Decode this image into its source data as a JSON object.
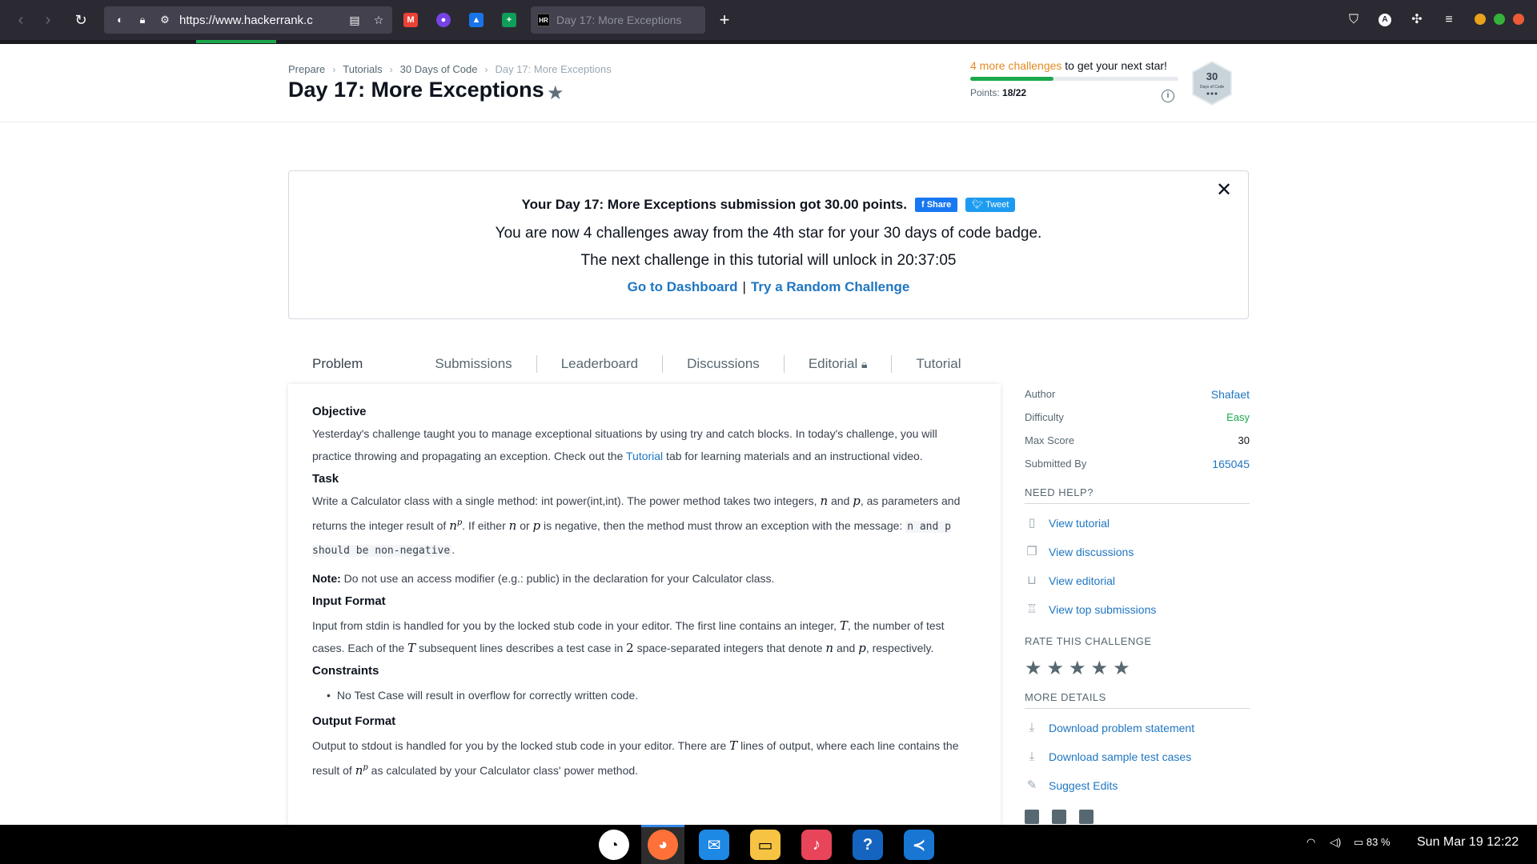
{
  "browser": {
    "url_host": "https://www.hackerrank.c",
    "tab_title": "Day 17: More Exceptions",
    "tab_favicon": "HR",
    "new_tab_glyph": "+"
  },
  "breadcrumb": [
    "Prepare",
    "Tutorials",
    "30 Days of Code",
    "Day 17: More Exceptions"
  ],
  "header": {
    "title": "Day 17: More Exceptions",
    "progress_accent": "4 more challenges",
    "progress_rest": " to get your next star!",
    "progress_fraction": 0.4,
    "points_label": "Points:",
    "points_value": "18/22",
    "badge_number": "30",
    "badge_caption": "Days of Code"
  },
  "success": {
    "message": "Your Day 17: More Exceptions submission got 30.00 points.",
    "share_label": "Share",
    "tweet_label": "Tweet",
    "line2": "You are now 4 challenges away from the 4th star for your 30 days of code badge.",
    "line3": "The next challenge in this tutorial will unlock in 20:37:05",
    "dashboard_link": "Go to Dashboard",
    "separator": "|",
    "random_link": "Try a Random Challenge"
  },
  "tabs": [
    "Problem",
    "Submissions",
    "Leaderboard",
    "Discussions",
    "Editorial",
    "Tutorial"
  ],
  "problem": {
    "objective_heading": "Objective",
    "objective_text_1": "Yesterday's challenge taught you to manage exceptional situations by using try and catch blocks. In today's challenge, you will practice throwing and propagating an exception. Check out the ",
    "objective_link": "Tutorial",
    "objective_text_2": " tab for learning materials and an instructional video.",
    "task_heading": "Task",
    "task_text_1": "Write a Calculator class with a single method: int power(int,int). The power method takes two integers, ",
    "task_text_2": " and ",
    "task_text_3": ", as parameters and returns the integer result of ",
    "task_text_4": ". If either ",
    "task_text_5": " or ",
    "task_text_6": " is negative, then the method must throw an exception with the message: ",
    "task_code": "n and p should be non-negative",
    "task_text_7": ".",
    "var_n": "n",
    "var_p": "p",
    "var_T": "T",
    "num_2": "2",
    "note_label": "Note:",
    "note_text": " Do not use an access modifier (e.g.: public) in the declaration for your Calculator class.",
    "input_heading": "Input Format",
    "input_text_1": "Input from stdin is handled for you by the locked stub code in your editor. The first line contains an integer, ",
    "input_text_2": ", the number of test cases. Each of the ",
    "input_text_3": " subsequent lines describes a test case in ",
    "input_text_4": " space-separated integers that denote ",
    "input_text_5": " and ",
    "input_text_6": ", respectively.",
    "constraints_heading": "Constraints",
    "constraint_1": "No Test Case will result in overflow for correctly written code.",
    "output_heading": "Output Format",
    "output_text_1": "Output to stdout is handled for you by the locked stub code in your editor. There are ",
    "output_text_2": " lines of output, where each line contains the result of ",
    "output_text_3": " as calculated by your Calculator class' power method."
  },
  "sidebar": {
    "meta": [
      {
        "key": "Author",
        "value": "Shafaet"
      },
      {
        "key": "Difficulty",
        "value": "Easy"
      },
      {
        "key": "Max Score",
        "value": "30"
      },
      {
        "key": "Submitted By",
        "value": "165045"
      }
    ],
    "need_help_heading": "NEED HELP?",
    "help_links": [
      "View tutorial",
      "View discussions",
      "View editorial",
      "View top submissions"
    ],
    "rate_heading": "RATE THIS CHALLENGE",
    "rating_stars": 5,
    "more_details_heading": "MORE DETAILS",
    "detail_links": [
      "Download problem statement",
      "Download sample test cases",
      "Suggest Edits"
    ]
  },
  "taskbar": {
    "battery": "83 %",
    "clock": "Sun Mar 19  12:22"
  },
  "colors": {
    "accent_link": "#1f76c2",
    "success_green": "#1ba94c",
    "progress_orange": "#e58a1f",
    "browser_bg": "#2b2a33"
  }
}
